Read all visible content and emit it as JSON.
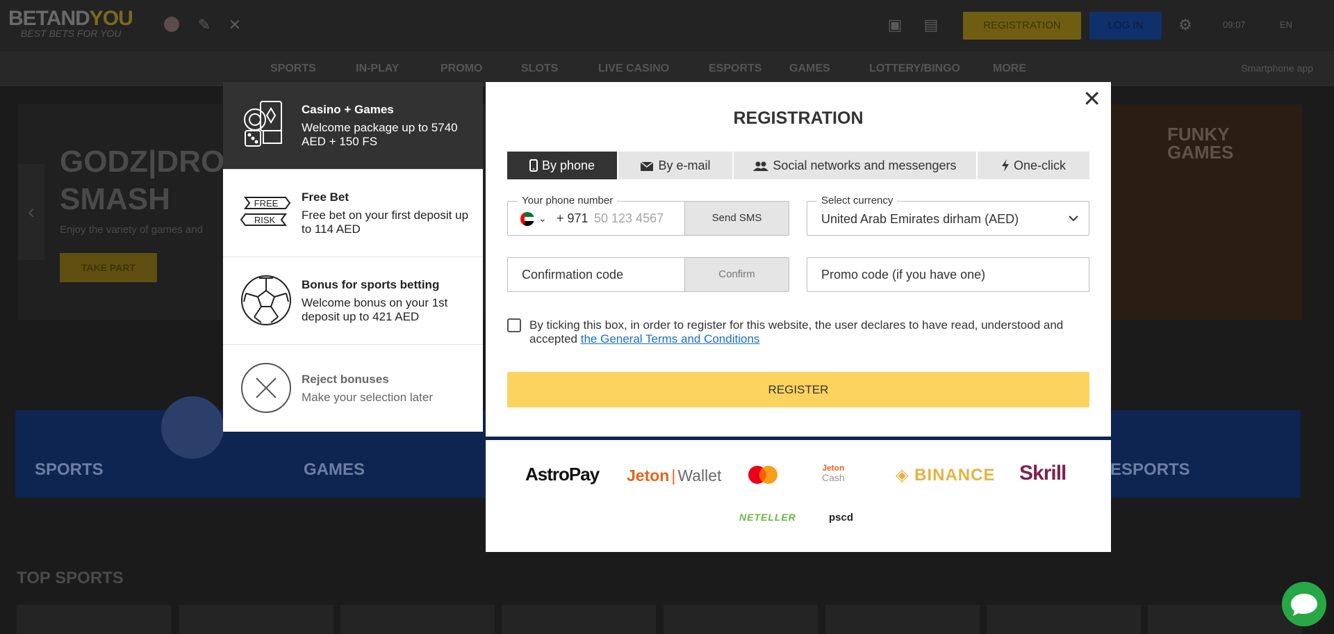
{
  "background": {
    "logo_main": "BETAND",
    "logo_accent": "YOU",
    "logo_tagline": "BEST BETS FOR YOU",
    "header": {
      "registration_label": "REGISTRATION",
      "login_label": "LOG IN",
      "time": "09:07",
      "language": "EN"
    },
    "nav": [
      "SPORTS",
      "IN-PLAY",
      "PROMO",
      "SLOTS",
      "LIVE CASINO",
      "ESPORTS",
      "GAMES",
      "LOTTERY/BINGO",
      "MORE"
    ],
    "nav_app": "Smartphone app",
    "hero": {
      "title_line1": "GODZ|DROP",
      "title_line2": "SMASH",
      "subtitle": "Enjoy the variety of games and",
      "button": "TAKE PART",
      "partner_logo_l1": "FUNKY",
      "partner_logo_l2": "GAMES"
    },
    "tiles": [
      "SPORTS",
      "GAMES",
      "ESPORTS"
    ],
    "top_sports": "TOP SPORTS"
  },
  "bonuses": [
    {
      "title": "Casino + Games",
      "desc": "Welcome package up to 5740 AED + 150 FS",
      "icon": "casino-games-icon",
      "active": true
    },
    {
      "title": "Free Bet",
      "desc": "Free bet on your first deposit up to 114 AED",
      "icon": "free-risk-icon",
      "icon_text_1": "FREE",
      "icon_text_2": "RISK"
    },
    {
      "title": "Bonus for sports betting",
      "desc": "Welcome bonus on your 1st deposit up to 421 AED",
      "icon": "soccer-ball-icon"
    },
    {
      "title": "Reject bonuses",
      "desc": "Make your selection later",
      "icon": "reject-icon"
    }
  ],
  "modal": {
    "title": "REGISTRATION",
    "tabs": [
      {
        "label": "By phone",
        "icon": "phone-icon",
        "active": true
      },
      {
        "label": "By e-mail",
        "icon": "envelope-icon"
      },
      {
        "label": "Social networks and messengers",
        "icon": "users-icon"
      },
      {
        "label": "One-click",
        "icon": "bolt-icon"
      }
    ],
    "phone": {
      "label": "Your phone number",
      "code": "+ 971",
      "placeholder": "50 123 4567",
      "send_sms": "Send SMS"
    },
    "currency": {
      "label": "Select currency",
      "value": "United Arab Emirates dirham (AED)"
    },
    "confirmation": {
      "placeholder": "Confirmation code",
      "confirm": "Confirm"
    },
    "promo": {
      "placeholder": "Promo code (if you have one)"
    },
    "terms_text": "By ticking this box, in order to register for this website, the user declares to have read, understood and accepted",
    "terms_link": "the General Terms and Conditions",
    "register": "REGISTER"
  },
  "payments": {
    "astropay": "AstroPay",
    "jeton_a": "Jeton",
    "jeton_sep": "|",
    "jeton_b": "Wallet",
    "jeton_cash_a": "Jeton",
    "jeton_cash_b": "Cash",
    "binance": "BINANCE",
    "skrill": "Skrill",
    "neteller": "NETELLER",
    "pscd": "pscd"
  },
  "colors": {
    "accent_yellow": "#fdd35f",
    "active_dark": "#333333",
    "link_blue": "#1a6fc4",
    "chat_green": "#28a745"
  }
}
